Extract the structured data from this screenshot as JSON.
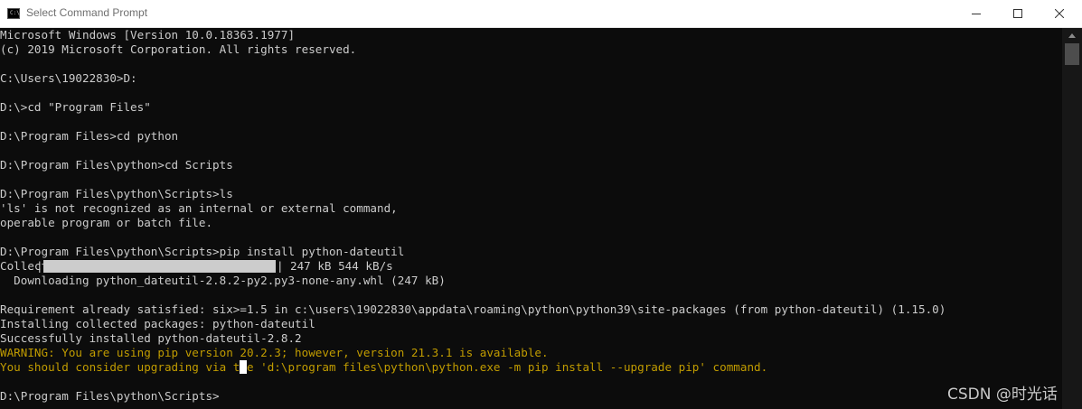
{
  "window": {
    "title": "Select Command Prompt",
    "app_icon_text": "C:\\",
    "icons": [
      "cmd-icon",
      "minimize-icon",
      "maximize-icon",
      "close-icon"
    ]
  },
  "console": {
    "lines": [
      {
        "text": "Microsoft Windows [Version 10.0.18363.1977]",
        "style": "normal"
      },
      {
        "text": "(c) 2019 Microsoft Corporation. All rights reserved.",
        "style": "normal"
      },
      {
        "text": "",
        "style": "normal"
      },
      {
        "text": "C:\\Users\\19022830>D:",
        "style": "normal"
      },
      {
        "text": "",
        "style": "normal"
      },
      {
        "text": "D:\\>cd \"Program Files\"",
        "style": "normal"
      },
      {
        "text": "",
        "style": "normal"
      },
      {
        "text": "D:\\Program Files>cd python",
        "style": "normal"
      },
      {
        "text": "",
        "style": "normal"
      },
      {
        "text": "D:\\Program Files\\python>cd Scripts",
        "style": "normal"
      },
      {
        "text": "",
        "style": "normal"
      },
      {
        "text": "D:\\Program Files\\python\\Scripts>ls",
        "style": "normal"
      },
      {
        "text": "'ls' is not recognized as an internal or external command,",
        "style": "normal"
      },
      {
        "text": "operable program or batch file.",
        "style": "normal"
      },
      {
        "text": "",
        "style": "normal"
      },
      {
        "text": "D:\\Program Files\\python\\Scripts>pip install python-dateutil",
        "style": "normal"
      },
      {
        "text": "Collecting python-dateutil",
        "style": "normal"
      },
      {
        "text": "  Downloading python_dateutil-2.8.2-py2.py3-none-any.whl (247 kB)",
        "style": "normal"
      },
      {
        "text": "",
        "style": "progress"
      },
      {
        "text": "Requirement already satisfied: six>=1.5 in c:\\users\\19022830\\appdata\\roaming\\python\\python39\\site-packages (from python-dateutil) (1.15.0)",
        "style": "normal"
      },
      {
        "text": "Installing collected packages: python-dateutil",
        "style": "normal"
      },
      {
        "text": "Successfully installed python-dateutil-2.8.2",
        "style": "normal"
      },
      {
        "text": "WARNING: You are using pip version 20.2.3; however, version 21.3.1 is available.",
        "style": "warn"
      },
      {
        "text": "You should consider upgrading via the 'd:\\program files\\python\\python.exe -m pip install --upgrade pip' command.",
        "style": "warn"
      },
      {
        "text": "",
        "style": "normal"
      },
      {
        "text": "D:\\Program Files\\python\\Scripts> ",
        "style": "normal"
      }
    ],
    "progress": {
      "fraction": 1.0,
      "status": "247 kB 544 kB/s",
      "pipe_char": "|"
    },
    "colors": {
      "background": "#0c0c0c",
      "text": "#cccccc",
      "warning": "#c19c00"
    }
  },
  "watermark": "CSDN @时光话"
}
